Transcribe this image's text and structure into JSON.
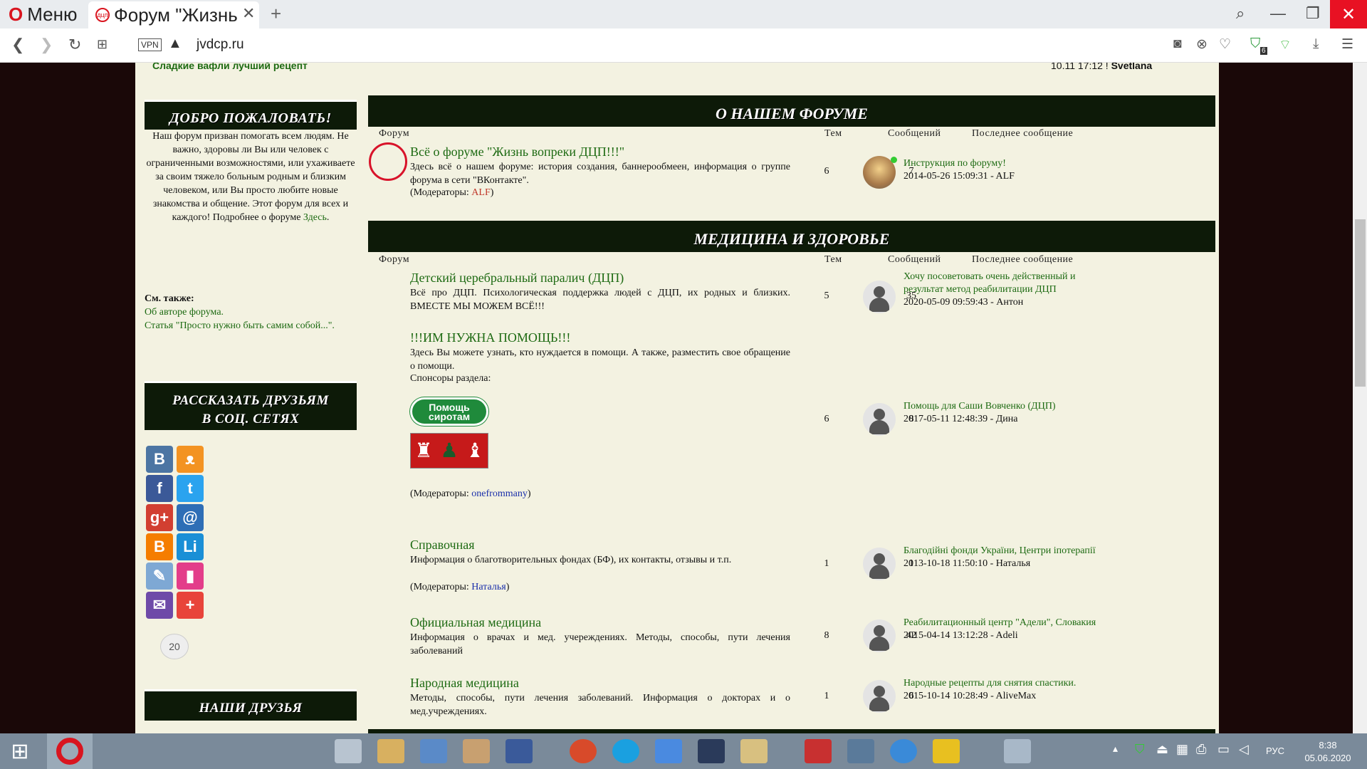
{
  "browser": {
    "menu_label": "Меню",
    "tab_title": "Форум \"Жизнь",
    "tab_close": "✕",
    "new_tab": "+",
    "vpn_label": "VPN",
    "url": "jvdcp.ru",
    "shield_count": "6"
  },
  "ticker": {
    "left": "Сладкие вафли лучший рецепт",
    "right_time": "10.11 17:12 !",
    "right_user": "Svetlana"
  },
  "sidebar": {
    "welcome_title": "ДОБРО ПОЖАЛОВАТЬ!",
    "welcome_text": "Наш форум призван помогать всем людям. Не важно, здоровы ли Вы или человек с ограниченными возможностями, или ухаживаете за своим тяжело больным родным и близким человеком, или Вы просто любите новые знакомства и общение. Этот форум для всех и каждого! Подробнее о форуме",
    "welcome_link": "Здесь",
    "see_also_title": "См. также:",
    "see_also_1": "Об авторе форума.",
    "see_also_2": "Статья \"Просто нужно быть самим собой...\".",
    "share_title_1": "РАССКАЗАТЬ ДРУЗЬЯМ",
    "share_title_2": "В СОЦ. СЕТЯХ",
    "share_count": "20",
    "friends_title": "НАШИ ДРУЗЬЯ",
    "social": [
      {
        "icon": "vk-icon",
        "glyph": "B",
        "color": "#4c75a3"
      },
      {
        "icon": "odnoklassniki-icon",
        "glyph": "ᴥ",
        "color": "#f39322"
      },
      {
        "icon": "facebook-icon",
        "glyph": "f",
        "color": "#3b5998"
      },
      {
        "icon": "twitter-icon",
        "glyph": "t",
        "color": "#2aa3ef"
      },
      {
        "icon": "googleplus-icon",
        "glyph": "g+",
        "color": "#d23f31"
      },
      {
        "icon": "mailru-icon",
        "glyph": "@",
        "color": "#2e6eb6"
      },
      {
        "icon": "blogger-icon",
        "glyph": "B",
        "color": "#f57d00"
      },
      {
        "icon": "liveinternet-icon",
        "glyph": "Li",
        "color": "#1a8fd6"
      },
      {
        "icon": "livejournal-icon",
        "glyph": "✎",
        "color": "#7ea8d4"
      },
      {
        "icon": "bookmark-icon",
        "glyph": "▮",
        "color": "#e33d8a"
      },
      {
        "icon": "email-icon",
        "glyph": "✉",
        "color": "#6e4aa8"
      },
      {
        "icon": "more-icon",
        "glyph": "+",
        "color": "#e8443a"
      }
    ]
  },
  "columns": {
    "forum": "Форум",
    "topics": "Тем",
    "messages": "Сообщений",
    "last_post": "Последнее сообщение"
  },
  "categories": [
    {
      "title": "О НАШЕМ ФОРУМЕ"
    },
    {
      "title": "МЕДИЦИНА И ЗДОРОВЬЕ"
    }
  ],
  "forums": {
    "about": {
      "title": "Всё о форуме \"Жизнь вопреки ДЦП!!!\"",
      "desc": "Здесь всё о нашем форуме: история создания, баннерообмеен, информация о группе форума в сети \"ВКонтакте\".",
      "mod_prefix": "(Модераторы: ",
      "mod": "ALF",
      "mod_suffix": ")",
      "topics": "6",
      "messages": "7",
      "last_title": "Инструкция по форуму!",
      "last_meta": "2014-05-26 15:09:31 - ALF"
    },
    "dcp": {
      "title": "Детский церебральный паралич (ДЦП)",
      "desc": "Всё про ДЦП. Психологическая поддержка людей с ДЦП, их родных и близких. ВМЕСТЕ МЫ МОЖЕМ ВСЁ!!!",
      "topics": "5",
      "messages": "35",
      "last_title": "Хочу посоветовать очень действенный и результат метод реабилитации ДЦП",
      "last_meta": "2020-05-09 09:59:43 - Антон"
    },
    "help": {
      "title": "!!!ИМ НУЖНА ПОМОЩЬ!!!",
      "desc": "Здесь Вы можете узнать, кто нуждается в помощи. А также, разместить свое обращение о помощи.",
      "sponsors": "Спонсоры раздела:",
      "badge1_line1": "Помощь",
      "badge1_line2": "сиротам",
      "mod_prefix": "(Модераторы: ",
      "mod": "onefrommany",
      "mod_suffix": ")",
      "topics": "6",
      "messages": "8",
      "last_title": "Помощь для Саши Вовченко (ДЦП)",
      "last_meta": "2017-05-11 12:48:39 - Дина"
    },
    "reference": {
      "title": "Справочная",
      "desc": "Информация о благотворительных фондах (БФ), их контакты, отзывы и т.п.",
      "mod_prefix": "(Модераторы: ",
      "mod": "Наталья",
      "mod_suffix": ")",
      "topics": "1",
      "messages": "1",
      "last_title": "Благодійні фонди України, Центри іпотерапії",
      "last_meta": "2013-10-18 11:50:10 - Наталья"
    },
    "official": {
      "title": "Официальная медицина",
      "desc": "Информация о врачах и мед. учереждениях. Методы, способы, пути лечения заболеваний",
      "topics": "8",
      "messages": "42",
      "last_title": "Реабилитационный центр \"Адели\", Словакия",
      "last_meta": "2015-04-14 13:12:28 - Adeli"
    },
    "folk": {
      "title": "Народная медицина",
      "desc": "Методы, способы, пути лечения заболеваний. Информация о докторах и о мед.учреждениях.",
      "topics": "1",
      "messages": "6",
      "last_title": "Народные рецепты для снятия спастики.",
      "last_meta": "2015-10-14 10:28:49 - AliveMax"
    }
  },
  "taskbar": {
    "lang": "РУС",
    "time": "8:38",
    "date": "05.06.2020"
  }
}
